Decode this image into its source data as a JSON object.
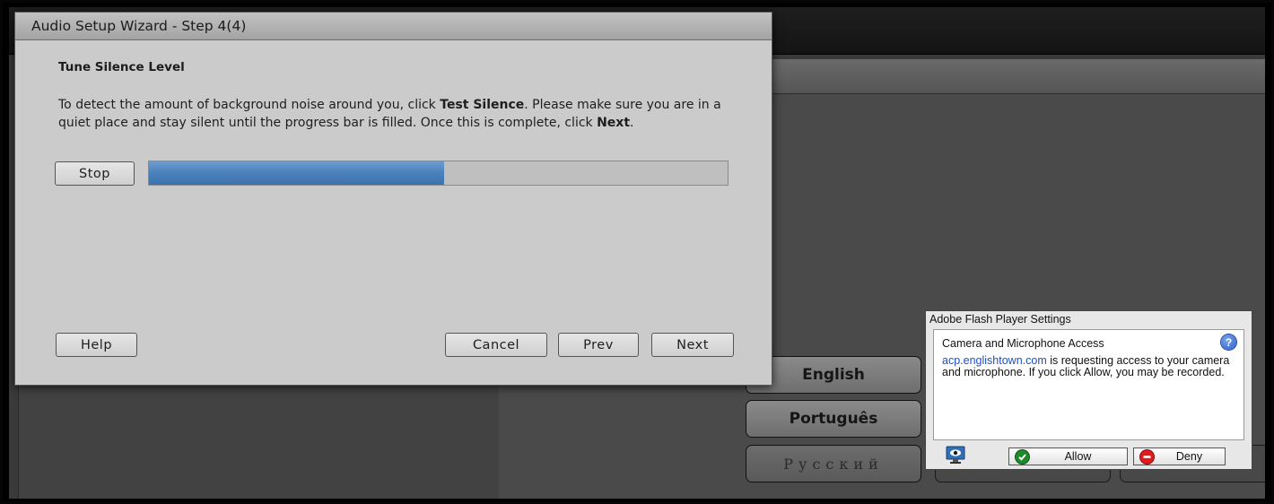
{
  "wizard": {
    "title": "Audio Setup Wizard - Step 4(4)",
    "heading": "Tune Silence Level",
    "instructions": {
      "part1": "To detect the amount of background noise around you, click ",
      "bold1": "Test Silence",
      "part2": ". Please make sure you are in a quiet place and stay silent until the progress bar is filled. Once this is complete, click ",
      "bold2": "Next",
      "part3": "."
    },
    "stop_label": "Stop",
    "progress_percent": 51,
    "help_label": "Help",
    "cancel_label": "Cancel",
    "prev_label": "Prev",
    "next_label": "Next"
  },
  "languages": {
    "english": "English",
    "portuguese": "Português",
    "russian": "Русский"
  },
  "flash_settings": {
    "title": "Adobe Flash Player Settings",
    "heading": "Camera and Microphone Access",
    "domain": "acp.englishtown.com",
    "message_rest": " is requesting access to your camera and microphone. If you click Allow, you may be recorded.",
    "allow_label": "Allow",
    "deny_label": "Deny",
    "icons": {
      "help": "help-question-icon",
      "camera": "camera-monitor-icon",
      "allow": "check-circle-icon",
      "deny": "no-entry-icon"
    }
  },
  "colors": {
    "progress_fill": "#4d83bd",
    "link": "#1d4fc4",
    "allow_green": "#1f8a2c",
    "deny_red": "#e11b1b"
  }
}
